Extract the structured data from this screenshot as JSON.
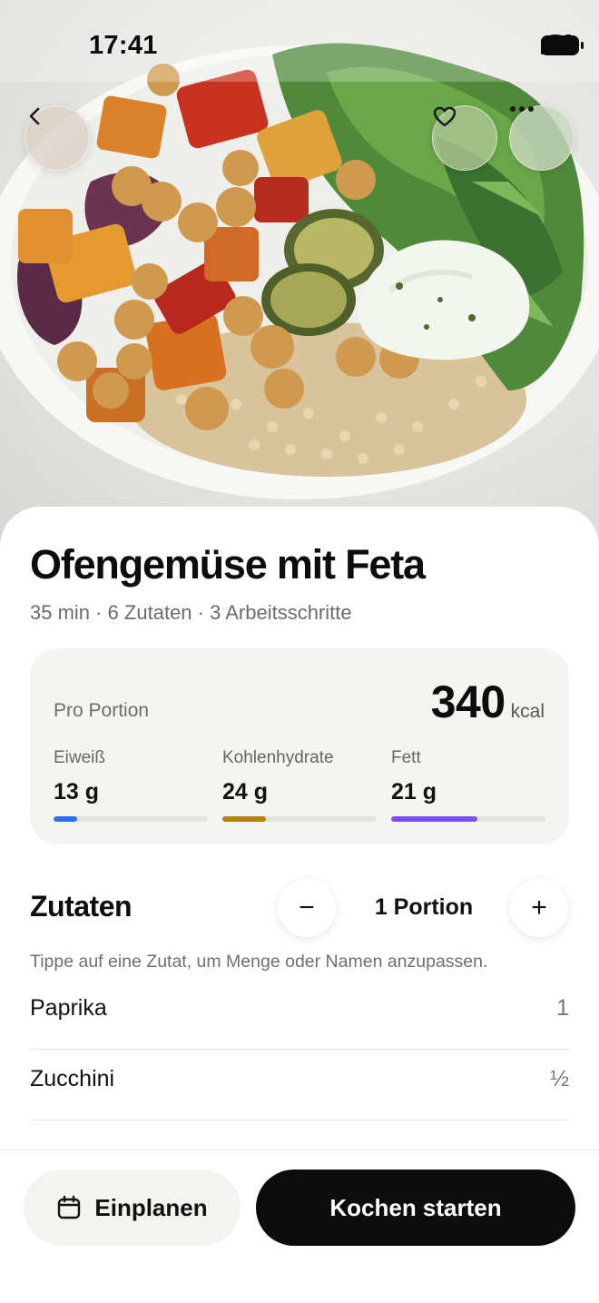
{
  "status_bar": {
    "time": "17:41",
    "signal_icon": "cellular-signal-icon",
    "wifi_icon": "wifi-icon",
    "battery_icon": "battery-icon"
  },
  "hero": {
    "image": "roasted-vegetable-bowl-photo",
    "back_icon": "chevron-left-icon",
    "favorite_icon": "heart-icon",
    "more_icon": "ellipsis-icon"
  },
  "recipe": {
    "title": "Ofengemüse mit Feta",
    "meta": "35 min · 6 Zutaten · 3 Arbeitsschritte"
  },
  "nutrition": {
    "label": "Pro Portion",
    "kcal": "340",
    "kcal_unit": "kcal",
    "macros": [
      {
        "label": "Eiweiß",
        "value": "13 g",
        "fill": 0.15,
        "color": "#2f6ff2"
      },
      {
        "label": "Kohlenhydrate",
        "value": "24 g",
        "fill": 0.28,
        "color": "#b5820c"
      },
      {
        "label": "Fett",
        "value": "21 g",
        "fill": 0.56,
        "color": "#7b4ef0"
      }
    ]
  },
  "ingredients": {
    "title": "Zutaten",
    "minus_label": "−",
    "plus_label": "+",
    "portion_label": "1 Portion",
    "hint": "Tippe auf eine Zutat, um Menge oder Namen anzupassen.",
    "items": [
      {
        "name": "Paprika",
        "qty": "1"
      },
      {
        "name": "Zucchini",
        "qty": "½"
      }
    ]
  },
  "actions": {
    "plan_icon": "calendar-icon",
    "plan_label": "Einplanen",
    "cook_label": "Kochen starten"
  }
}
